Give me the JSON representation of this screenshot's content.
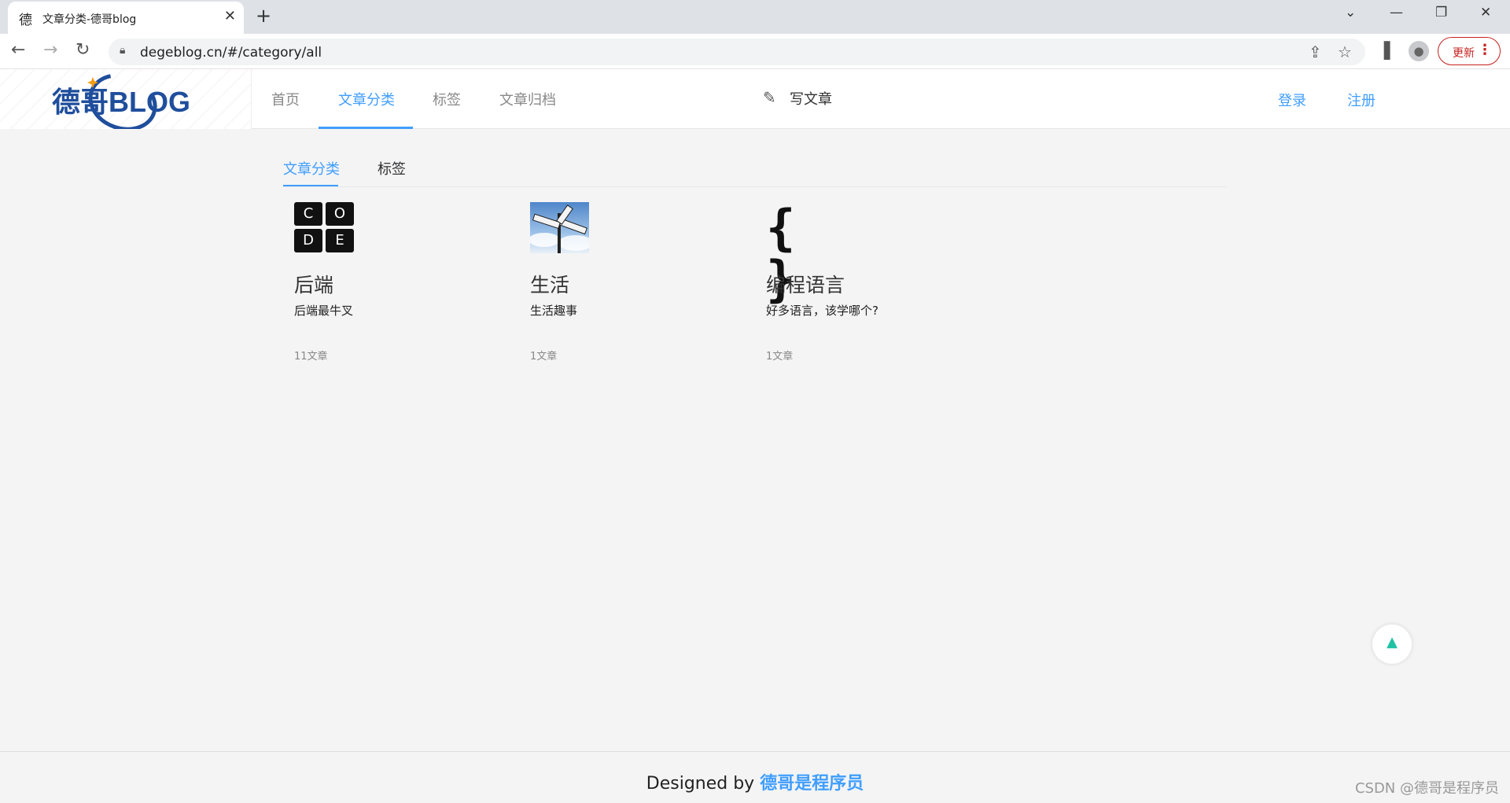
{
  "browser": {
    "tab_favicon": "德",
    "tab_title": "文章分类-德哥blog",
    "tab_close": "✕",
    "new_tab": "+",
    "url": "degeblog.cn/#/category/all",
    "update_label": "更新"
  },
  "site": {
    "logo_text": "德哥BLOG",
    "nav": [
      {
        "label": "首页"
      },
      {
        "label": "文章分类"
      },
      {
        "label": "标签"
      },
      {
        "label": "文章归档"
      }
    ],
    "write_label": "写文章",
    "login": "登录",
    "register": "注册"
  },
  "subtabs": {
    "categories": "文章分类",
    "tags": "标签"
  },
  "categories": [
    {
      "name": "后端",
      "desc": "后端最牛叉",
      "count": "11文章",
      "icon": "code-logo"
    },
    {
      "name": "生活",
      "desc": "生活趣事",
      "count": "1文章",
      "icon": "signpost-photo"
    },
    {
      "name": "编程语言",
      "desc": "好多语言，该学哪个?",
      "count": "1文章",
      "icon": "braces-icon"
    }
  ],
  "code_letters": [
    "C",
    "O",
    "D",
    "E"
  ],
  "braces": "{ }",
  "footer": {
    "prefix": "Designed by ",
    "brand": "德哥是程序员",
    "watermark": "CSDN @德哥是程序员"
  },
  "colors": {
    "accent": "#409eff",
    "backtop": "#1ec2a4"
  }
}
